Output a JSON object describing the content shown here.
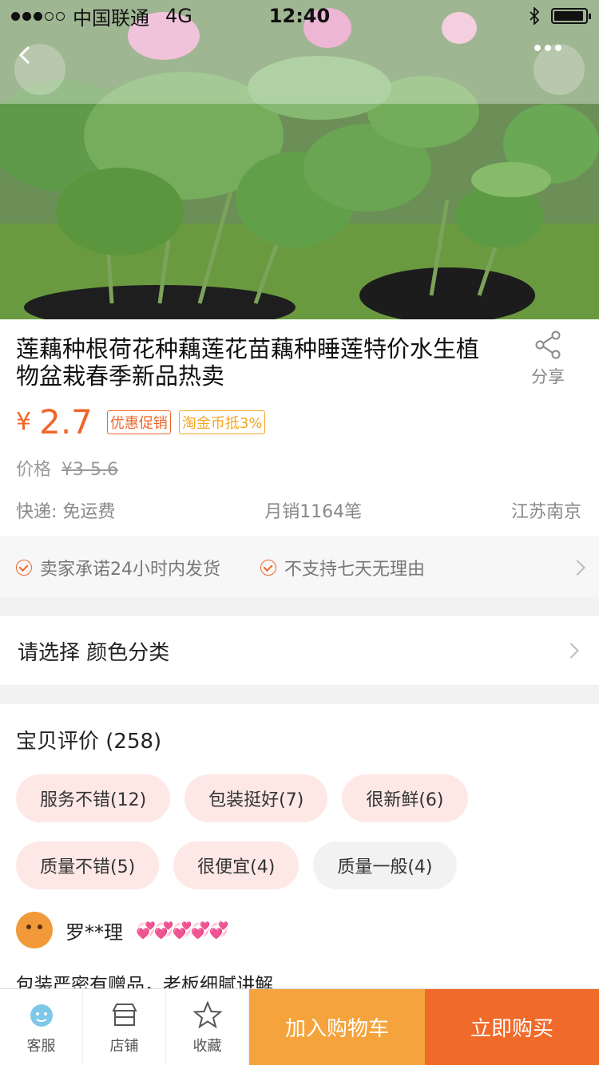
{
  "status": {
    "carrier": "中国联通",
    "network": "4G",
    "time": "12:40",
    "signal_bars": 3
  },
  "product": {
    "title": "莲藕种根荷花种藕莲花苗藕种睡莲特价水生植物盆栽春季新品热卖",
    "share_label": "分享",
    "currency": "¥",
    "price": "2.7",
    "tags": [
      "优惠促销",
      "淘金币抵3%"
    ],
    "orig_label": "价格",
    "orig_price": "¥3-5.6",
    "shipping": "快递: 免运费",
    "monthly_sales": "月销1164笔",
    "location": "江苏南京",
    "promises": [
      "卖家承诺24小时内发货",
      "不支持七天无理由"
    ]
  },
  "select": {
    "label": "请选择 颜色分类"
  },
  "reviews": {
    "title": "宝贝评价",
    "count": "(258)",
    "tags": [
      {
        "label": "服务不错(12)",
        "tone": "positive"
      },
      {
        "label": "包装挺好(7)",
        "tone": "positive"
      },
      {
        "label": "很新鲜(6)",
        "tone": "positive"
      },
      {
        "label": "质量不错(5)",
        "tone": "positive"
      },
      {
        "label": "很便宜(4)",
        "tone": "positive"
      },
      {
        "label": "质量一般(4)",
        "tone": "neutral"
      }
    ],
    "first": {
      "user": "罗**理",
      "hearts": "💞💞💞💞💞",
      "text": "包装严密有赠品，老板细腻讲解"
    }
  },
  "bottom": {
    "service_label": "客服",
    "shop_label": "店铺",
    "fav_label": "收藏",
    "cart_label": "加入购物车",
    "buy_label": "立即购买"
  },
  "colors": {
    "accent": "#f0662a",
    "cart": "#f5a33c",
    "tag_bg": "#fde8e6"
  }
}
